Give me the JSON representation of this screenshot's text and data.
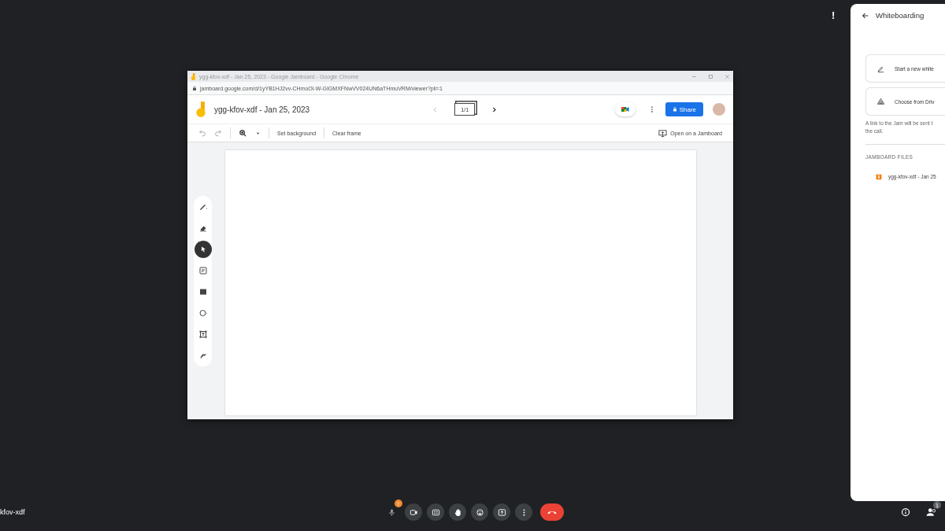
{
  "alert": "!",
  "browser": {
    "title": "ygg-kfov-xdf - Jan 25, 2023 - Google Jamboard - Google Chrome",
    "url": "jamboard.google.com/d/1yYB1HJ2vv-CHmoOi-W-GIGMXFNwVV024UN6aTHmuVRM/viewer?pli=1"
  },
  "jam": {
    "title": "ygg-kfov-xdf - Jan 25, 2023",
    "frame_counter": "1/1",
    "share": "Share",
    "toolbar": [
      "Set background",
      "Clear frame"
    ],
    "open_on": "Open on a Jamboard",
    "tools": [
      {
        "kind": "pen",
        "selected": false
      },
      {
        "kind": "eraser",
        "selected": false
      },
      {
        "kind": "select",
        "selected": true
      },
      {
        "kind": "note",
        "selected": false
      },
      {
        "kind": "image",
        "selected": false
      },
      {
        "kind": "circle",
        "selected": false
      },
      {
        "kind": "textbox",
        "selected": false
      },
      {
        "kind": "laser",
        "selected": false
      }
    ]
  },
  "panel": {
    "title": "Whiteboarding",
    "options": [
      {
        "kind": "pencil",
        "label": "Start a new white"
      },
      {
        "kind": "drive",
        "label": "Choose from Driv"
      }
    ],
    "note": "A link to the Jam will be sent t\nthe call.",
    "section": "JAMBOARD FILES",
    "files": [
      "ygg-kfov-xdf - Jan 25"
    ]
  },
  "meeting_name": "kfov-xdf",
  "call_controls": [
    {
      "kind": "mic",
      "badge": "!"
    },
    {
      "kind": "camera"
    },
    {
      "kind": "captions"
    },
    {
      "kind": "hand"
    },
    {
      "kind": "emoji"
    },
    {
      "kind": "present"
    },
    {
      "kind": "more"
    },
    {
      "kind": "hangup"
    }
  ],
  "participants_badge": "1"
}
